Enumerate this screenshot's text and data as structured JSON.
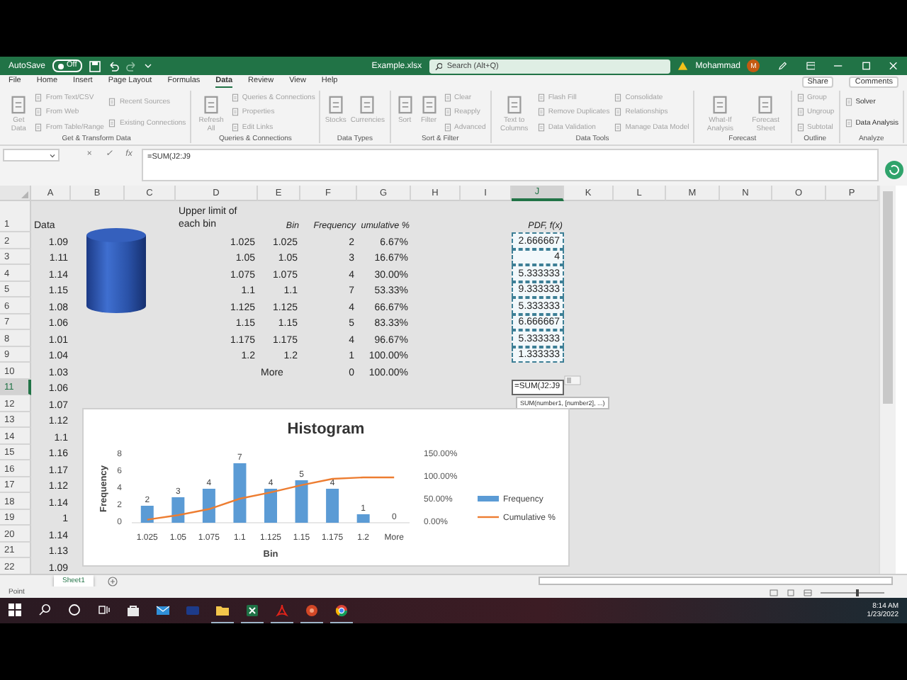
{
  "title_bar": {
    "autosave_label": "AutoSave",
    "autosave": {
      "label": "Off",
      "on": false
    },
    "file_name": "Example.xlsx",
    "search": {
      "placeholder": "Search (Alt+Q)"
    },
    "user_name": "Mohammad",
    "avatar_initial": "M"
  },
  "ribbon_tabs": [
    {
      "label": "File",
      "selected": false
    },
    {
      "label": "Home",
      "selected": false
    },
    {
      "label": "Insert",
      "selected": false
    },
    {
      "label": "Page Layout",
      "selected": false
    },
    {
      "label": "Formulas",
      "selected": false
    },
    {
      "label": "Data",
      "selected": true
    },
    {
      "label": "Review",
      "selected": false
    },
    {
      "label": "View",
      "selected": false
    },
    {
      "label": "Help",
      "selected": false
    }
  ],
  "ribbon_actions": [
    "Share",
    "Comments"
  ],
  "ribbon_groups": [
    {
      "label": "Get & Transform Data",
      "buttons": [
        {
          "label": "Get Data",
          "kind": "large",
          "disabled": true
        },
        {
          "label": "From Text/CSV",
          "kind": "small",
          "disabled": true
        },
        {
          "label": "From Web",
          "kind": "small",
          "disabled": true
        },
        {
          "label": "From Table/Range",
          "kind": "small",
          "disabled": true
        },
        {
          "label": "Recent Sources",
          "kind": "small",
          "disabled": true
        },
        {
          "label": "Existing Connections",
          "kind": "small",
          "disabled": true
        }
      ]
    },
    {
      "label": "Queries & Connections",
      "buttons": [
        {
          "label": "Refresh All",
          "kind": "large",
          "disabled": true
        },
        {
          "label": "Queries & Connections",
          "kind": "small",
          "disabled": true
        },
        {
          "label": "Properties",
          "kind": "small",
          "disabled": true
        },
        {
          "label": "Edit Links",
          "kind": "small",
          "disabled": true
        }
      ]
    },
    {
      "label": "Data Types",
      "buttons": [
        {
          "label": "Stocks",
          "kind": "large",
          "disabled": true
        },
        {
          "label": "Currencies",
          "kind": "large",
          "disabled": true
        }
      ]
    },
    {
      "label": "Sort & Filter",
      "buttons": [
        {
          "label": "Sort",
          "kind": "large",
          "disabled": true
        },
        {
          "label": "Filter",
          "kind": "large",
          "disabled": true
        },
        {
          "label": "Clear",
          "kind": "small",
          "disabled": true
        },
        {
          "label": "Reapply",
          "kind": "small",
          "disabled": true
        },
        {
          "label": "Advanced",
          "kind": "small",
          "disabled": true
        }
      ]
    },
    {
      "label": "Data Tools",
      "buttons": [
        {
          "label": "Text to Columns",
          "kind": "large",
          "disabled": true
        },
        {
          "label": "Flash Fill",
          "kind": "small",
          "disabled": true
        },
        {
          "label": "Remove Duplicates",
          "kind": "small",
          "disabled": true
        },
        {
          "label": "Data Validation",
          "kind": "small",
          "disabled": true
        },
        {
          "label": "Consolidate",
          "kind": "small",
          "disabled": true
        },
        {
          "label": "Relationships",
          "kind": "small",
          "disabled": true
        },
        {
          "label": "Manage Data Model",
          "kind": "small",
          "disabled": true
        }
      ]
    },
    {
      "label": "Forecast",
      "buttons": [
        {
          "label": "What-If Analysis",
          "kind": "large",
          "disabled": true
        },
        {
          "label": "Forecast Sheet",
          "kind": "large",
          "disabled": true
        }
      ]
    },
    {
      "label": "Outline",
      "buttons": [
        {
          "label": "Group",
          "kind": "small",
          "disabled": true
        },
        {
          "label": "Ungroup",
          "kind": "small",
          "disabled": true
        },
        {
          "label": "Subtotal",
          "kind": "small",
          "disabled": true
        }
      ]
    },
    {
      "label": "Analyze",
      "buttons": [
        {
          "label": "Solver",
          "kind": "small",
          "disabled": false
        },
        {
          "label": "Data Analysis",
          "kind": "small",
          "disabled": false
        }
      ]
    }
  ],
  "formula_bar": {
    "buttons": [
      "×",
      "✓",
      "fx"
    ],
    "formula": "=SUM(J2:J9"
  },
  "sheet": {
    "columns": [
      {
        "label": "A",
        "selected": false
      },
      {
        "label": "B",
        "selected": false
      },
      {
        "label": "C",
        "selected": false
      },
      {
        "label": "D",
        "selected": false
      },
      {
        "label": "E",
        "selected": false
      },
      {
        "label": "F",
        "selected": false
      },
      {
        "label": "G",
        "selected": false
      },
      {
        "label": "H",
        "selected": false
      },
      {
        "label": "I",
        "selected": false
      },
      {
        "label": "J",
        "selected": true
      },
      {
        "label": "K",
        "selected": false
      },
      {
        "label": "L",
        "selected": false
      },
      {
        "label": "M",
        "selected": false
      },
      {
        "label": "N",
        "selected": false
      },
      {
        "label": "O",
        "selected": false
      },
      {
        "label": "P",
        "selected": false
      }
    ],
    "rows": [
      {
        "number": "1",
        "selected": false,
        "cells": [
          {
            "text": "Data",
            "kind": "text",
            "highlighted": false
          },
          null,
          null,
          {
            "text": "Upper limit of each bin",
            "kind": "wrap",
            "highlighted": false
          },
          {
            "text": "Bin",
            "kind": "header",
            "highlighted": false
          },
          {
            "text": "Frequency",
            "kind": "header",
            "highlighted": false
          },
          {
            "text": "umulative %",
            "kind": "header",
            "highlighted": false
          },
          null,
          null,
          {
            "text": "PDF, f(x)",
            "kind": "header",
            "highlighted": false
          }
        ]
      },
      {
        "number": "2",
        "selected": false,
        "cells": [
          {
            "text": "1.09",
            "kind": "number",
            "highlighted": false
          },
          null,
          null,
          {
            "text": "1.025",
            "kind": "number",
            "highlighted": false
          },
          {
            "text": "1.025",
            "kind": "number",
            "highlighted": false
          },
          {
            "text": "2",
            "kind": "number",
            "highlighted": false
          },
          {
            "text": "6.67%",
            "kind": "number",
            "highlighted": false
          },
          null,
          null,
          {
            "text": "2.666667",
            "kind": "number",
            "highlighted": true
          }
        ]
      },
      {
        "number": "3",
        "selected": false,
        "cells": [
          {
            "text": "1.11",
            "kind": "number",
            "highlighted": false
          },
          null,
          null,
          {
            "text": "1.05",
            "kind": "number",
            "highlighted": false
          },
          {
            "text": "1.05",
            "kind": "number",
            "highlighted": false
          },
          {
            "text": "3",
            "kind": "number",
            "highlighted": false
          },
          {
            "text": "16.67%",
            "kind": "number",
            "highlighted": false
          },
          null,
          null,
          {
            "text": "4",
            "kind": "number",
            "highlighted": true
          }
        ]
      },
      {
        "number": "4",
        "selected": false,
        "cells": [
          {
            "text": "1.14",
            "kind": "number",
            "highlighted": false
          },
          null,
          null,
          {
            "text": "1.075",
            "kind": "number",
            "highlighted": false
          },
          {
            "text": "1.075",
            "kind": "number",
            "highlighted": false
          },
          {
            "text": "4",
            "kind": "number",
            "highlighted": false
          },
          {
            "text": "30.00%",
            "kind": "number",
            "highlighted": false
          },
          null,
          null,
          {
            "text": "5.333333",
            "kind": "number",
            "highlighted": true
          }
        ]
      },
      {
        "number": "5",
        "selected": false,
        "cells": [
          {
            "text": "1.15",
            "kind": "number",
            "highlighted": false
          },
          null,
          null,
          {
            "text": "1.1",
            "kind": "number",
            "highlighted": false
          },
          {
            "text": "1.1",
            "kind": "number",
            "highlighted": false
          },
          {
            "text": "7",
            "kind": "number",
            "highlighted": false
          },
          {
            "text": "53.33%",
            "kind": "number",
            "highlighted": false
          },
          null,
          null,
          {
            "text": "9.333333",
            "kind": "number",
            "highlighted": true
          }
        ]
      },
      {
        "number": "6",
        "selected": false,
        "cells": [
          {
            "text": "1.08",
            "kind": "number",
            "highlighted": false
          },
          null,
          null,
          {
            "text": "1.125",
            "kind": "number",
            "highlighted": false
          },
          {
            "text": "1.125",
            "kind": "number",
            "highlighted": false
          },
          {
            "text": "4",
            "kind": "number",
            "highlighted": false
          },
          {
            "text": "66.67%",
            "kind": "number",
            "highlighted": false
          },
          null,
          null,
          {
            "text": "5.333333",
            "kind": "number",
            "highlighted": true
          }
        ]
      },
      {
        "number": "7",
        "selected": false,
        "cells": [
          {
            "text": "1.06",
            "kind": "number",
            "highlighted": false
          },
          null,
          null,
          {
            "text": "1.15",
            "kind": "number",
            "highlighted": false
          },
          {
            "text": "1.15",
            "kind": "number",
            "highlighted": false
          },
          {
            "text": "5",
            "kind": "number",
            "highlighted": false
          },
          {
            "text": "83.33%",
            "kind": "number",
            "highlighted": false
          },
          null,
          null,
          {
            "text": "6.666667",
            "kind": "number",
            "highlighted": true
          }
        ]
      },
      {
        "number": "8",
        "selected": false,
        "cells": [
          {
            "text": "1.01",
            "kind": "number",
            "highlighted": false
          },
          null,
          null,
          {
            "text": "1.175",
            "kind": "number",
            "highlighted": false
          },
          {
            "text": "1.175",
            "kind": "number",
            "highlighted": false
          },
          {
            "text": "4",
            "kind": "number",
            "highlighted": false
          },
          {
            "text": "96.67%",
            "kind": "number",
            "highlighted": false
          },
          null,
          null,
          {
            "text": "5.333333",
            "kind": "number",
            "highlighted": true
          }
        ]
      },
      {
        "number": "9",
        "selected": false,
        "cells": [
          {
            "text": "1.04",
            "kind": "number",
            "highlighted": false
          },
          null,
          null,
          {
            "text": "1.2",
            "kind": "number",
            "highlighted": false
          },
          {
            "text": "1.2",
            "kind": "number",
            "highlighted": false
          },
          {
            "text": "1",
            "kind": "number",
            "highlighted": false
          },
          {
            "text": "100.00%",
            "kind": "number",
            "highlighted": false
          },
          null,
          null,
          {
            "text": "1.333333",
            "kind": "number",
            "highlighted": true
          }
        ]
      },
      {
        "number": "10",
        "selected": false,
        "cells": [
          {
            "text": "1.03",
            "kind": "number",
            "highlighted": false
          },
          null,
          null,
          null,
          {
            "text": "More",
            "kind": "text",
            "highlighted": false
          },
          {
            "text": "0",
            "kind": "number",
            "highlighted": false
          },
          {
            "text": "100.00%",
            "kind": "number",
            "highlighted": false
          }
        ]
      },
      {
        "number": "11",
        "selected": true,
        "cells": [
          {
            "text": "1.06",
            "kind": "number",
            "highlighted": false
          },
          null,
          null,
          null,
          null,
          null,
          null,
          null,
          null,
          {
            "text": "=SUM(J2:J9",
            "kind": "editing",
            "highlighted": false
          }
        ]
      },
      {
        "number": "12",
        "selected": false,
        "cells": [
          {
            "text": "1.07",
            "kind": "number",
            "highlighted": false
          }
        ]
      },
      {
        "number": "13",
        "selected": false,
        "cells": [
          {
            "text": "1.12",
            "kind": "number",
            "highlighted": false
          }
        ]
      },
      {
        "number": "14",
        "selected": false,
        "cells": [
          {
            "text": "1.1",
            "kind": "number",
            "highlighted": false
          }
        ]
      },
      {
        "number": "15",
        "selected": false,
        "cells": [
          {
            "text": "1.16",
            "kind": "number",
            "highlighted": false
          }
        ]
      },
      {
        "number": "16",
        "selected": false,
        "cells": [
          {
            "text": "1.17",
            "kind": "number",
            "highlighted": false
          }
        ]
      },
      {
        "number": "17",
        "selected": false,
        "cells": [
          {
            "text": "1.12",
            "kind": "number",
            "highlighted": false
          }
        ]
      },
      {
        "number": "18",
        "selected": false,
        "cells": [
          {
            "text": "1.14",
            "kind": "number",
            "highlighted": false
          }
        ]
      },
      {
        "number": "19",
        "selected": false,
        "cells": [
          {
            "text": "1",
            "kind": "number",
            "highlighted": false
          }
        ]
      },
      {
        "number": "20",
        "selected": false,
        "cells": [
          {
            "text": "1.14",
            "kind": "number",
            "highlighted": false
          }
        ]
      },
      {
        "number": "21",
        "selected": false,
        "cells": [
          {
            "text": "1.13",
            "kind": "number",
            "highlighted": false
          }
        ]
      },
      {
        "number": "22",
        "selected": false,
        "cells": [
          {
            "text": "1.09",
            "kind": "number",
            "highlighted": false
          }
        ]
      }
    ],
    "function_tooltip": "SUM(number1, [number2], ...)",
    "chart": {
      "frequency": {
        "chart_data": {
          "type": "bar",
          "title": "Histogram",
          "xlabel": "Bin",
          "ylabel": "Frequency",
          "categories": [
            "1.025",
            "1.05",
            "1.075",
            "1.1",
            "1.125",
            "1.15",
            "1.175",
            "1.2",
            "More"
          ],
          "series": [
            {
              "name": "Frequency",
              "color": "#5b9bd5",
              "values": [
                2,
                3,
                4,
                7,
                4,
                5,
                4,
                1,
                0
              ]
            }
          ],
          "ylim": [
            0,
            8
          ],
          "yticks": [
            0,
            2,
            4,
            6,
            8
          ],
          "data_labels": true
        }
      },
      "cumulative": {
        "chart_data": {
          "type": "line",
          "categories": [
            null,
            null,
            null,
            null,
            null,
            null,
            null,
            null,
            null
          ],
          "series": [
            {
              "name": "Cumulative %",
              "color": "#ed7d31",
              "values": [
                7,
                17,
                30,
                53,
                67,
                83,
                97,
                100,
                100
              ]
            }
          ],
          "ylim": [
            0,
            150
          ],
          "yticks": [
            {
              "value": 0,
              "label": "0.00%"
            },
            {
              "value": 50,
              "label": "50.00%"
            },
            {
              "value": 100,
              "label": "100.00%"
            },
            {
              "value": 150,
              "label": "150.00%"
            }
          ]
        }
      }
    }
  },
  "sheet_tabs": [
    {
      "label": "Sheet1",
      "selected": true
    }
  ],
  "status_bar": {
    "mode": "Point",
    "zoom": {
      "level": 0.55
    }
  },
  "taskbar": {
    "apps": [
      {
        "open": false
      },
      {
        "open": false
      },
      {
        "open": false
      },
      {
        "open": true
      },
      {
        "open": true
      },
      {
        "open": true
      },
      {
        "open": true
      },
      {
        "open": true
      }
    ],
    "time": "8:14 AM",
    "date": "1/23/2022"
  }
}
